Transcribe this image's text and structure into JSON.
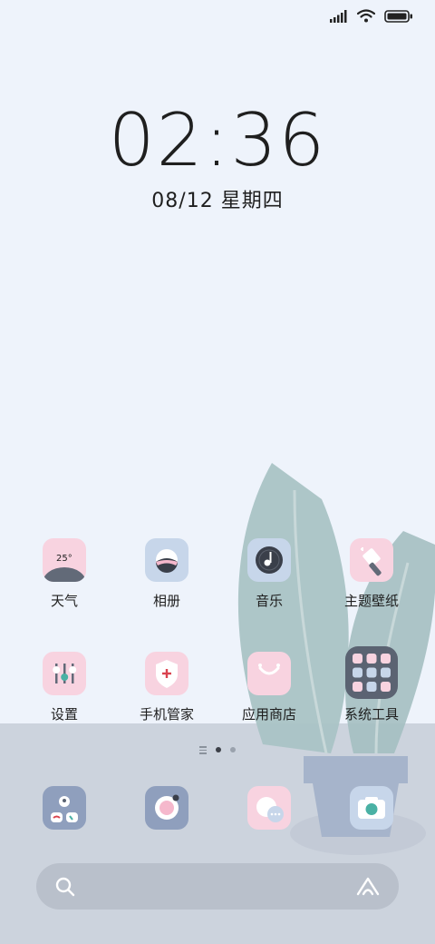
{
  "status": {
    "icons": [
      "signal-icon",
      "wifi-icon",
      "battery-icon"
    ]
  },
  "lockscreen": {
    "time": "02:36",
    "date": "08/12 星期四"
  },
  "apps": [
    {
      "label": "天气",
      "icon": "weather-icon",
      "temp": "25°"
    },
    {
      "label": "相册",
      "icon": "gallery-icon"
    },
    {
      "label": "音乐",
      "icon": "music-icon"
    },
    {
      "label": "主题壁纸",
      "icon": "themes-icon"
    },
    {
      "label": "设置",
      "icon": "settings-icon"
    },
    {
      "label": "手机管家",
      "icon": "security-icon"
    },
    {
      "label": "应用商店",
      "icon": "app-store-icon"
    },
    {
      "label": "系统工具",
      "icon": "tools-folder-icon"
    }
  ],
  "dock": [
    {
      "icon": "phone-icon"
    },
    {
      "icon": "camera-lens-icon"
    },
    {
      "icon": "messages-icon"
    },
    {
      "icon": "camera-icon"
    }
  ],
  "pager": {
    "pages": 2,
    "active": 0
  },
  "search": {
    "left_icon": "search-icon",
    "right_icon": "assistant-icon"
  },
  "colors": {
    "background": "#eef3fb",
    "floor": "#ccd3dd",
    "accent_pink": "#f8d3e0",
    "accent_blue": "#c7d6ea"
  }
}
